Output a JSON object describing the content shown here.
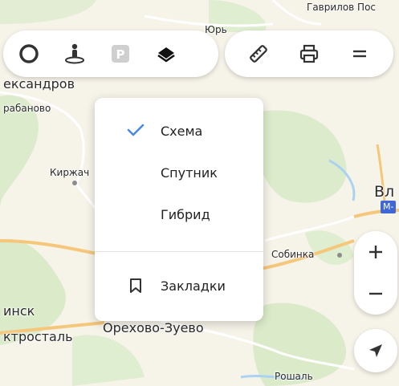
{
  "map": {
    "labels": {
      "gavrilov": "Гаврилов Пос",
      "yurev": "Юрь",
      "aleksandrov": "ександров",
      "karabanovo": "рабаново",
      "kirzhach": "Киржач",
      "vladimir": "Вл",
      "sobinka": "Собинка",
      "minsk": "инск",
      "elektrostal": "ктросталь",
      "orekhovo": "Орехово-Зуево",
      "roshal": "Рошаль"
    },
    "road_badge": "M-",
    "colors": {
      "land": "#f6f3e9",
      "forest": "#d6e9c4",
      "road_major": "#f5c77a",
      "road_minor": "#ffffff",
      "water": "#aad3f2"
    }
  },
  "toolbar_left": {
    "buttons": [
      {
        "name": "traffic",
        "icon": "traffic-ring-icon"
      },
      {
        "name": "panorama",
        "icon": "panorama-person-icon"
      },
      {
        "name": "parking",
        "icon": "parking-icon",
        "label": "P"
      },
      {
        "name": "layers",
        "icon": "layers-icon",
        "active": true
      }
    ]
  },
  "toolbar_right": {
    "buttons": [
      {
        "name": "ruler",
        "icon": "ruler-icon"
      },
      {
        "name": "print",
        "icon": "printer-icon"
      },
      {
        "name": "menu",
        "icon": "menu-icon"
      }
    ]
  },
  "layers_menu": {
    "options": [
      {
        "label": "Схема",
        "selected": true
      },
      {
        "label": "Спутник",
        "selected": false
      },
      {
        "label": "Гибрид",
        "selected": false
      }
    ],
    "bookmarks_label": "Закладки",
    "accent": "#4a8ae8"
  },
  "zoom": {
    "in": "+",
    "out": "−"
  }
}
